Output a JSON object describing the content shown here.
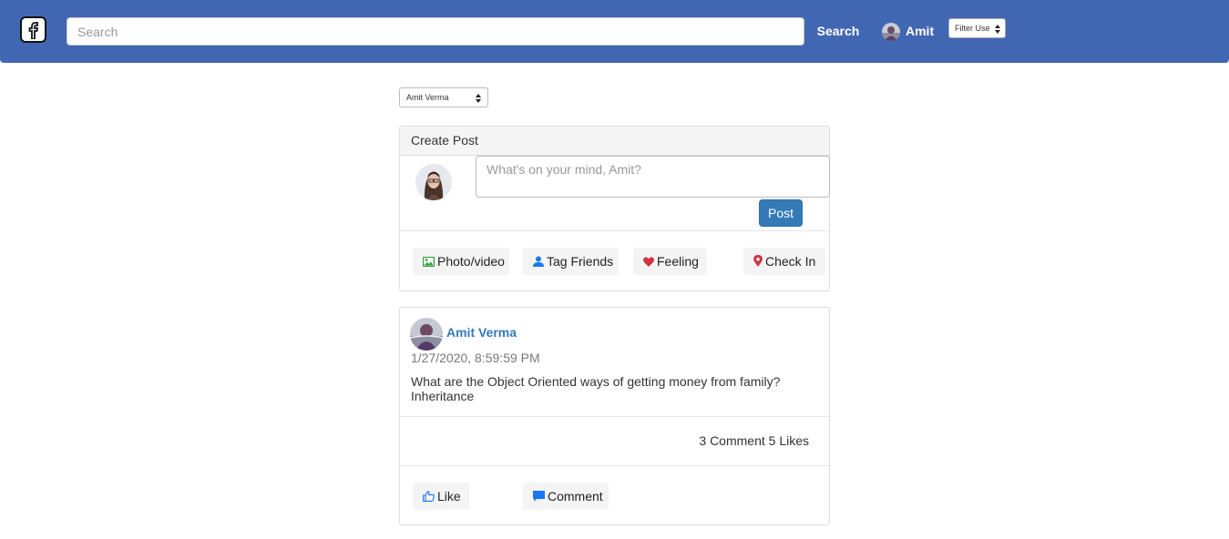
{
  "navbar": {
    "logo_icon": "facebook-logo-icon",
    "search_placeholder": "Search",
    "search_button": "Search",
    "user_name": "Amit",
    "filter_label": "Filter Use"
  },
  "user_select": {
    "selected": "Amit Verma"
  },
  "create_post": {
    "heading": "Create Post",
    "placeholder": "What's on your mind, Amit?",
    "post_button": "Post",
    "actions": [
      {
        "label": "Photo/video",
        "icon": "image-icon",
        "color": "#2e9e3e"
      },
      {
        "label": "Tag Friends",
        "icon": "user-icon",
        "color": "#1877f2"
      },
      {
        "label": "Feeling",
        "icon": "heart-icon",
        "color": "#d0353f"
      },
      {
        "label": "Check In",
        "icon": "map-marker-icon",
        "color": "#d0353f"
      }
    ]
  },
  "post": {
    "author": "Amit Verma",
    "timestamp": "1/27/2020, 8:59:59 PM",
    "text": "What are the Object Oriented ways of getting money from family? Inheritance",
    "stats": "3 Comment 5 Likes",
    "like_label": "Like",
    "comment_label": "Comment"
  },
  "colors": {
    "navbar": "#4267b2",
    "link": "#337ab7",
    "primary_button": "#337ab7"
  }
}
